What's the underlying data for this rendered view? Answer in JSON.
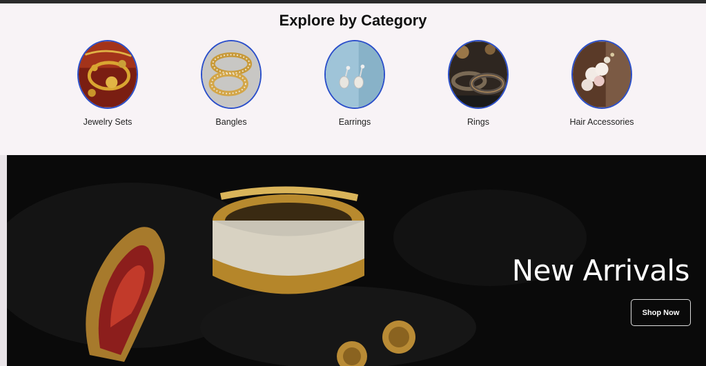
{
  "section_title": "Explore by Category",
  "categories": [
    {
      "label": "Jewelry Sets",
      "icon": "jewelry-set-image"
    },
    {
      "label": "Bangles",
      "icon": "bangles-image"
    },
    {
      "label": "Earrings",
      "icon": "earrings-image"
    },
    {
      "label": "Rings",
      "icon": "rings-image"
    },
    {
      "label": "Hair Accessories",
      "icon": "hair-accessories-image"
    }
  ],
  "banner": {
    "title": "New Arrivals",
    "button_label": "Shop Now"
  },
  "colors": {
    "accent_border": "#2b4fc9",
    "section_bg": "#f8f3f6",
    "banner_bg": "#0b0b0b"
  }
}
